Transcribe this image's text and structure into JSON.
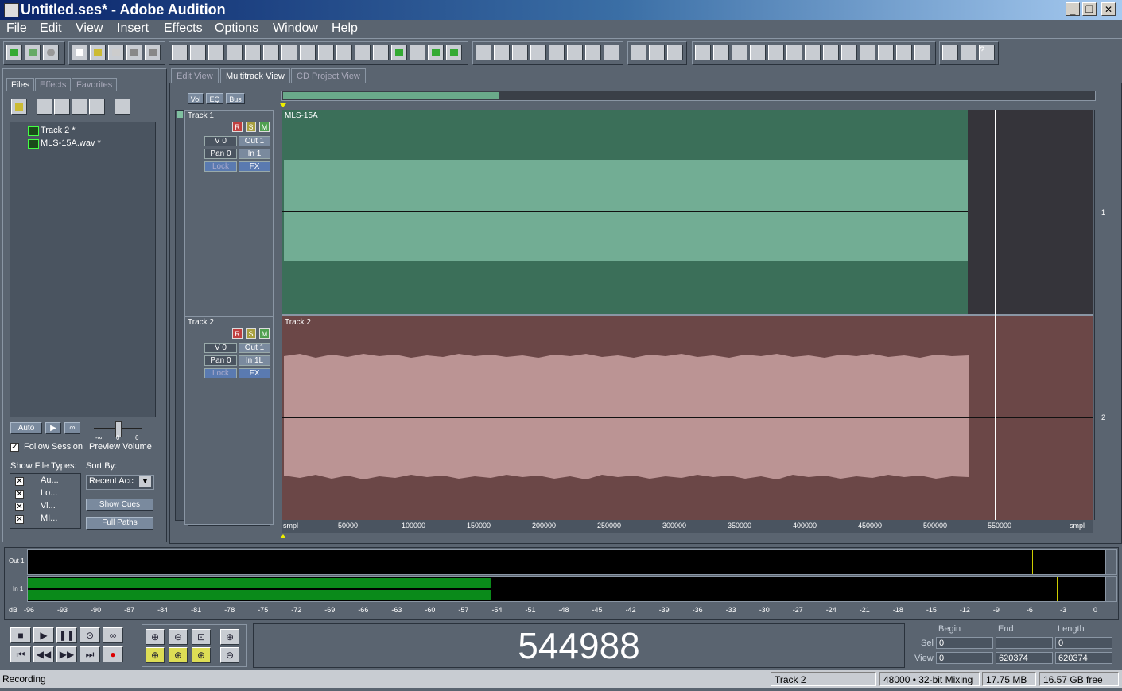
{
  "window": {
    "title": "Untitled.ses* - Adobe Audition"
  },
  "menu": [
    "File",
    "Edit",
    "View",
    "Insert",
    "Effects",
    "Options",
    "Window",
    "Help"
  ],
  "left_panel": {
    "tabs": [
      "Files",
      "Effects",
      "Favorites"
    ],
    "files": [
      "Track 2 *",
      "MLS-15A.wav *"
    ],
    "auto_label": "Auto",
    "follow_session": "Follow Session",
    "preview_volume": "Preview Volume",
    "slider_min": "-∞",
    "slider_mid": "0",
    "slider_max": "6",
    "show_file_types": "Show File Types:",
    "sort_by": "Sort By:",
    "sort_value": "Recent Acc",
    "file_types": [
      "Au...",
      "Lo...",
      "Vi...",
      "MI..."
    ],
    "show_cues": "Show Cues",
    "full_paths": "Full Paths"
  },
  "view_tabs": [
    "Edit View",
    "Multitrack View",
    "CD Project View"
  ],
  "track_tabs": [
    "Vol",
    "EQ",
    "Bus"
  ],
  "tracks": [
    {
      "name": "Track 1",
      "clip": "MLS-15A",
      "vol": "V 0",
      "out": "Out 1",
      "pan": "Pan 0",
      "in": "In 1",
      "lock": "Lock",
      "fx": "FX",
      "r": "R",
      "s": "S",
      "m": "M",
      "num": "1"
    },
    {
      "name": "Track 2",
      "clip": "Track 2",
      "vol": "V 0",
      "out": "Out 1",
      "pan": "Pan 0",
      "in": "In 1L",
      "lock": "Lock",
      "fx": "FX",
      "r": "R",
      "s": "S",
      "m": "M",
      "num": "2"
    }
  ],
  "ruler": [
    "smpl",
    "50000",
    "100000",
    "150000",
    "200000",
    "250000",
    "300000",
    "350000",
    "400000",
    "450000",
    "500000",
    "550000",
    "smpl"
  ],
  "meters": {
    "out_label": "Out 1",
    "in_label": "In 1",
    "db_label": "dB",
    "ticks": [
      "-96",
      "-93",
      "-90",
      "-87",
      "-84",
      "-81",
      "-78",
      "-75",
      "-72",
      "-69",
      "-66",
      "-63",
      "-60",
      "-57",
      "-54",
      "-51",
      "-48",
      "-45",
      "-42",
      "-39",
      "-36",
      "-33",
      "-30",
      "-27",
      "-24",
      "-21",
      "-18",
      "-15",
      "-12",
      "-9",
      "-6",
      "-3",
      "0"
    ],
    "in_level_fraction": 0.43
  },
  "time_display": "544988",
  "sel_view": {
    "headers": [
      "Begin",
      "End",
      "Length"
    ],
    "sel_label": "Sel",
    "view_label": "View",
    "sel": [
      "0",
      "",
      "0"
    ],
    "view": [
      "0",
      "620374",
      "620374"
    ]
  },
  "status": {
    "left": "Recording",
    "track": "Track 2",
    "format": "48000 • 32-bit Mixing",
    "size": "17.75 MB",
    "free": "16.57 GB free"
  },
  "colors": {
    "accent": "#3b6f59",
    "track2": "#6b4747"
  }
}
